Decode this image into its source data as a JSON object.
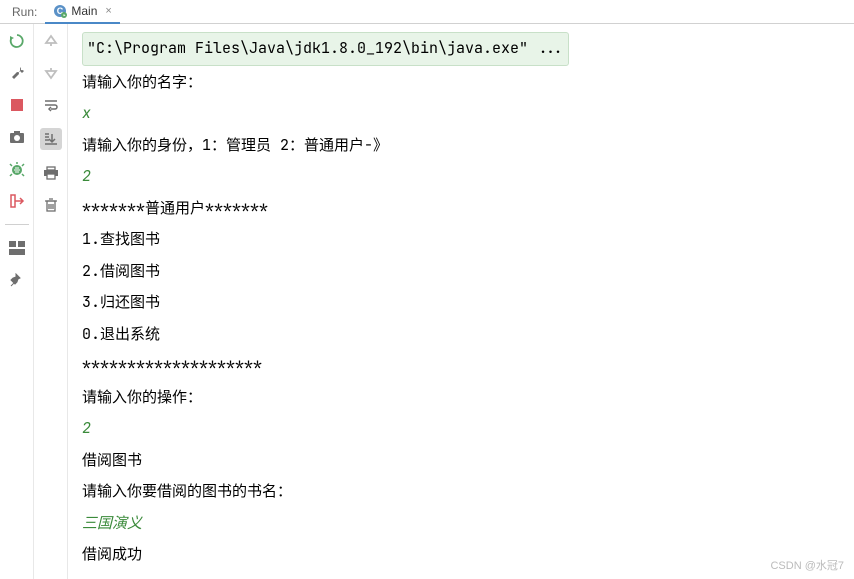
{
  "topbar": {
    "run_label": "Run:",
    "tab_label": "Main",
    "close": "×"
  },
  "console": {
    "cmd": "\"C:\\Program Files\\Java\\jdk1.8.0_192\\bin\\java.exe\" ...",
    "lines": [
      {
        "text": "请输入你的名字：",
        "cls": ""
      },
      {
        "text": "x",
        "cls": "input-green"
      },
      {
        "text": "请输入你的身份，1：管理员   2：普通用户-》",
        "cls": ""
      },
      {
        "text": "2",
        "cls": "input-green"
      },
      {
        "text": "*******普通用户*******",
        "cls": ""
      },
      {
        "text": "1.查找图书",
        "cls": ""
      },
      {
        "text": "2.借阅图书",
        "cls": ""
      },
      {
        "text": "3.归还图书",
        "cls": ""
      },
      {
        "text": "0.退出系统",
        "cls": ""
      },
      {
        "text": "********************",
        "cls": ""
      },
      {
        "text": "请输入你的操作：",
        "cls": ""
      },
      {
        "text": "2",
        "cls": "input-green"
      },
      {
        "text": "借阅图书",
        "cls": ""
      },
      {
        "text": "请输入你要借阅的图书的书名：",
        "cls": ""
      },
      {
        "text": "三国演义",
        "cls": "input-green"
      },
      {
        "text": "借阅成功",
        "cls": ""
      }
    ]
  },
  "watermark": "CSDN @水冠7"
}
